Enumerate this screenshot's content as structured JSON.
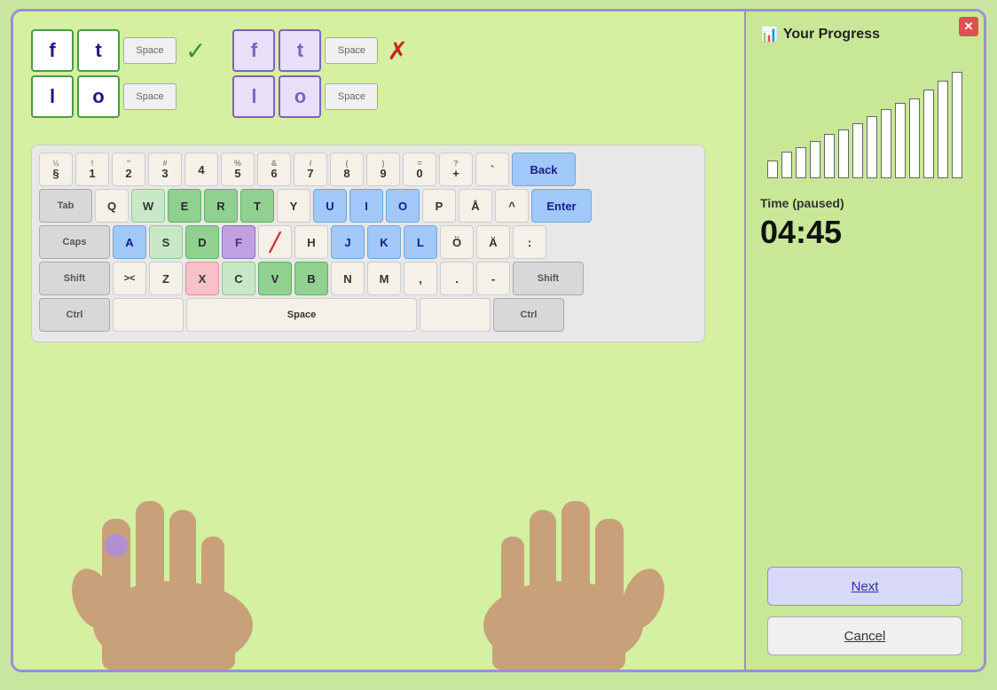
{
  "window": {
    "close_label": "✕"
  },
  "word_display": {
    "correct_word": {
      "row1": [
        "f",
        "t",
        "Space"
      ],
      "row2": [
        "l",
        "o",
        "Space"
      ],
      "status": "correct"
    },
    "attempt_word": {
      "row1": [
        "f",
        "t",
        "Space"
      ],
      "row2": [
        "l",
        "o",
        "Space"
      ],
      "status": "incorrect"
    }
  },
  "keyboard": {
    "row1": [
      {
        "label": "½\n§",
        "color": "beige"
      },
      {
        "label": "1\n!",
        "color": "beige"
      },
      {
        "label": "2\n\"",
        "color": "beige"
      },
      {
        "label": "3\n#",
        "color": "beige"
      },
      {
        "label": "4",
        "color": "beige"
      },
      {
        "label": "5\n%",
        "color": "beige"
      },
      {
        "label": "6\n&",
        "color": "beige"
      },
      {
        "label": "7\n/",
        "color": "beige"
      },
      {
        "label": "8\n(",
        "color": "beige"
      },
      {
        "label": "9\n)",
        "color": "beige"
      },
      {
        "label": "0\n=",
        "color": "beige"
      },
      {
        "label": "?\n+",
        "color": "beige"
      },
      {
        "label": "`",
        "color": "beige"
      },
      {
        "label": "Back",
        "color": "blue",
        "wide": true
      }
    ],
    "row2": [
      {
        "label": "Tab",
        "color": "gray",
        "wide": true
      },
      {
        "label": "Q",
        "color": "beige"
      },
      {
        "label": "W",
        "color": "light-green"
      },
      {
        "label": "E",
        "color": "green"
      },
      {
        "label": "R",
        "color": "green"
      },
      {
        "label": "T",
        "color": "green"
      },
      {
        "label": "Y",
        "color": "beige"
      },
      {
        "label": "U",
        "color": "blue"
      },
      {
        "label": "I",
        "color": "blue"
      },
      {
        "label": "O",
        "color": "blue"
      },
      {
        "label": "P",
        "color": "beige"
      },
      {
        "label": "Å",
        "color": "beige"
      },
      {
        "label": "^",
        "color": "beige"
      },
      {
        "label": "Enter",
        "color": "blue",
        "wide": true
      }
    ],
    "row3": [
      {
        "label": "Caps",
        "color": "gray",
        "wide": true
      },
      {
        "label": "A",
        "color": "blue"
      },
      {
        "label": "S",
        "color": "light-green"
      },
      {
        "label": "D",
        "color": "green"
      },
      {
        "label": "F",
        "color": "purple"
      },
      {
        "label": "/",
        "color": "slash"
      },
      {
        "label": "H",
        "color": "beige"
      },
      {
        "label": "J",
        "color": "blue"
      },
      {
        "label": "K",
        "color": "blue"
      },
      {
        "label": "L",
        "color": "blue"
      },
      {
        "label": "Ö",
        "color": "beige"
      },
      {
        "label": "Ä",
        "color": "beige"
      },
      {
        "label": ":",
        "color": "beige"
      }
    ],
    "row4": [
      {
        "label": "Shift",
        "color": "gray",
        "wide": true
      },
      {
        "label": "><",
        "color": "beige"
      },
      {
        "label": "Z",
        "color": "beige"
      },
      {
        "label": "X",
        "color": "pink"
      },
      {
        "label": "C",
        "color": "light-green"
      },
      {
        "label": "V",
        "color": "green"
      },
      {
        "label": "B",
        "color": "green"
      },
      {
        "label": "N",
        "color": "beige"
      },
      {
        "label": "M",
        "color": "beige"
      },
      {
        "label": ",",
        "color": "beige"
      },
      {
        "label": ".",
        "color": "beige"
      },
      {
        "label": "-",
        "color": "beige"
      },
      {
        "label": "Shift",
        "color": "gray",
        "wide": true
      }
    ],
    "row5": [
      {
        "label": "Ctrl",
        "color": "gray",
        "wide": true
      },
      {
        "label": "",
        "color": "beige"
      },
      {
        "label": "Space",
        "color": "beige",
        "space": true
      },
      {
        "label": "",
        "color": "beige"
      },
      {
        "label": "Ctrl",
        "color": "gray",
        "wide": true
      }
    ]
  },
  "progress": {
    "title": "Your Progress",
    "icon": "📊",
    "bars": [
      20,
      30,
      35,
      42,
      50,
      55,
      62,
      70,
      78,
      85,
      90,
      100,
      110,
      120
    ],
    "time_label": "Time (paused)",
    "time_value": "04:45"
  },
  "buttons": {
    "next_label": "Next",
    "cancel_label": "Cancel"
  }
}
